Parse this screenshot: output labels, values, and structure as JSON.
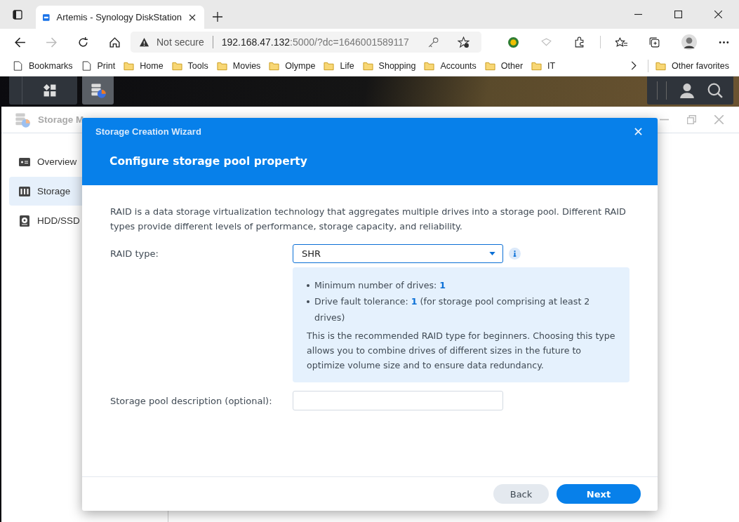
{
  "browser": {
    "tabs": [
      {
        "title": "Artemis - Synology DiskStation",
        "selected": true
      }
    ],
    "address": {
      "security": "Not secure",
      "host": "192.168.47.132",
      "rest": ":5000/?dc=1646001589117"
    },
    "bookmarks": [
      {
        "label": "Bookmarks",
        "kind": "page"
      },
      {
        "label": "Print",
        "kind": "page"
      },
      {
        "label": "Home",
        "kind": "folder"
      },
      {
        "label": "Tools",
        "kind": "folder"
      },
      {
        "label": "Movies",
        "kind": "folder"
      },
      {
        "label": "Olympe",
        "kind": "folder"
      },
      {
        "label": "Life",
        "kind": "folder"
      },
      {
        "label": "Shopping",
        "kind": "folder"
      },
      {
        "label": "Accounts",
        "kind": "folder"
      },
      {
        "label": "Other",
        "kind": "folder"
      },
      {
        "label": "IT",
        "kind": "folder"
      }
    ],
    "other_favorites": "Other favorites"
  },
  "app": {
    "title": "Storage M",
    "sidebar": [
      {
        "label": "Overview",
        "kind": "overview",
        "selected": false
      },
      {
        "label": "Storage",
        "kind": "storage",
        "selected": true
      },
      {
        "label": "HDD/SSD",
        "kind": "disk",
        "selected": false
      }
    ]
  },
  "wizard": {
    "title": "Storage Creation Wizard",
    "heading": "Configure storage pool property",
    "description": "RAID is a data storage virtualization technology that aggregates multiple drives into a storage pool. Different RAID types provide different levels of performance, storage capacity, and reliability.",
    "raid_type": {
      "label": "RAID type:",
      "value": "SHR"
    },
    "info": {
      "bullets": [
        "Minimum number of drives: **1**",
        "Drive fault tolerance: **1** (for storage pool comprising at least 2 drives)"
      ],
      "note": "This is the recommended RAID type for beginners. Choosing this type allows you to combine drives of different sizes in the future to optimize volume size and to ensure data redundancy."
    },
    "pool_description": {
      "label": "Storage pool description (optional):"
    },
    "buttons": {
      "back": "Back",
      "next": "Next"
    }
  }
}
